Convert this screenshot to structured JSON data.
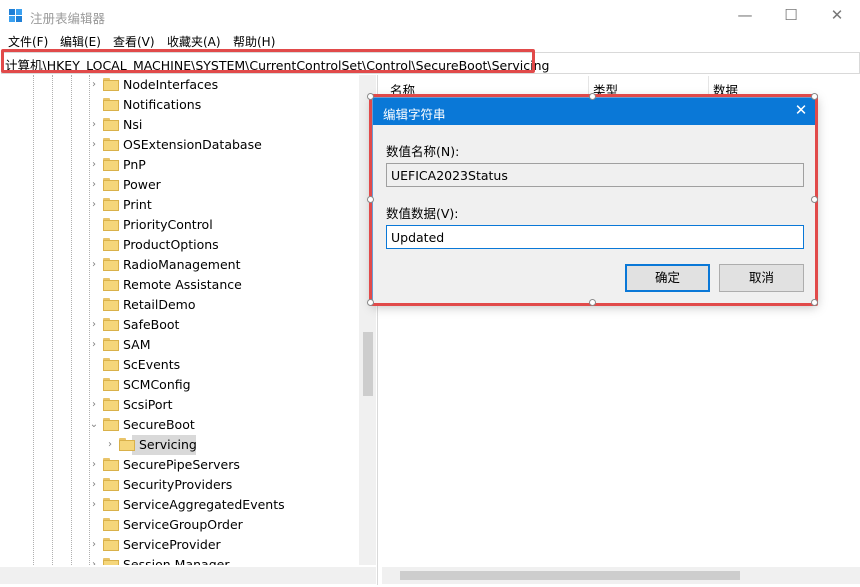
{
  "window": {
    "title": "注册表编辑器",
    "minimize": "—",
    "maximize": "☐",
    "close": "✕"
  },
  "menu": [
    "文件(F)",
    "编辑(E)",
    "查看(V)",
    "收藏夹(A)",
    "帮助(H)"
  ],
  "address": "计算机\\HKEY_LOCAL_MACHINE\\SYSTEM\\CurrentControlSet\\Control\\SecureBoot\\Servicing",
  "tree": [
    {
      "label": "NodeInterfaces",
      "expand": "›",
      "level": 0
    },
    {
      "label": "Notifications",
      "expand": "",
      "level": 0
    },
    {
      "label": "Nsi",
      "expand": "›",
      "level": 0
    },
    {
      "label": "OSExtensionDatabase",
      "expand": "›",
      "level": 0
    },
    {
      "label": "PnP",
      "expand": "›",
      "level": 0
    },
    {
      "label": "Power",
      "expand": "›",
      "level": 0
    },
    {
      "label": "Print",
      "expand": "›",
      "level": 0
    },
    {
      "label": "PriorityControl",
      "expand": "",
      "level": 0
    },
    {
      "label": "ProductOptions",
      "expand": "",
      "level": 0
    },
    {
      "label": "RadioManagement",
      "expand": "›",
      "level": 0
    },
    {
      "label": "Remote Assistance",
      "expand": "",
      "level": 0
    },
    {
      "label": "RetailDemo",
      "expand": "",
      "level": 0
    },
    {
      "label": "SafeBoot",
      "expand": "›",
      "level": 0
    },
    {
      "label": "SAM",
      "expand": "›",
      "level": 0
    },
    {
      "label": "ScEvents",
      "expand": "",
      "level": 0
    },
    {
      "label": "SCMConfig",
      "expand": "",
      "level": 0
    },
    {
      "label": "ScsiPort",
      "expand": "›",
      "level": 0
    },
    {
      "label": "SecureBoot",
      "expand": "⌄",
      "level": 0
    },
    {
      "label": "Servicing",
      "expand": "›",
      "level": 1,
      "selected": true
    },
    {
      "label": "SecurePipeServers",
      "expand": "›",
      "level": 0
    },
    {
      "label": "SecurityProviders",
      "expand": "›",
      "level": 0
    },
    {
      "label": "ServiceAggregatedEvents",
      "expand": "›",
      "level": 0
    },
    {
      "label": "ServiceGroupOrder",
      "expand": "",
      "level": 0
    },
    {
      "label": "ServiceProvider",
      "expand": "›",
      "level": 0
    },
    {
      "label": "Session Manager",
      "expand": "›",
      "level": 0
    }
  ],
  "columns": {
    "name": "名称",
    "type": "类型",
    "data": "数据"
  },
  "dialog": {
    "title": "编辑字符串",
    "close": "✕",
    "name_label": "数值名称(N):",
    "name_value": "UEFICA2023Status",
    "data_label": "数值数据(V):",
    "data_value": "Updated",
    "ok": "确定",
    "cancel": "取消"
  },
  "colors": {
    "accent": "#0a78d7",
    "highlight": "#e14a4a"
  }
}
